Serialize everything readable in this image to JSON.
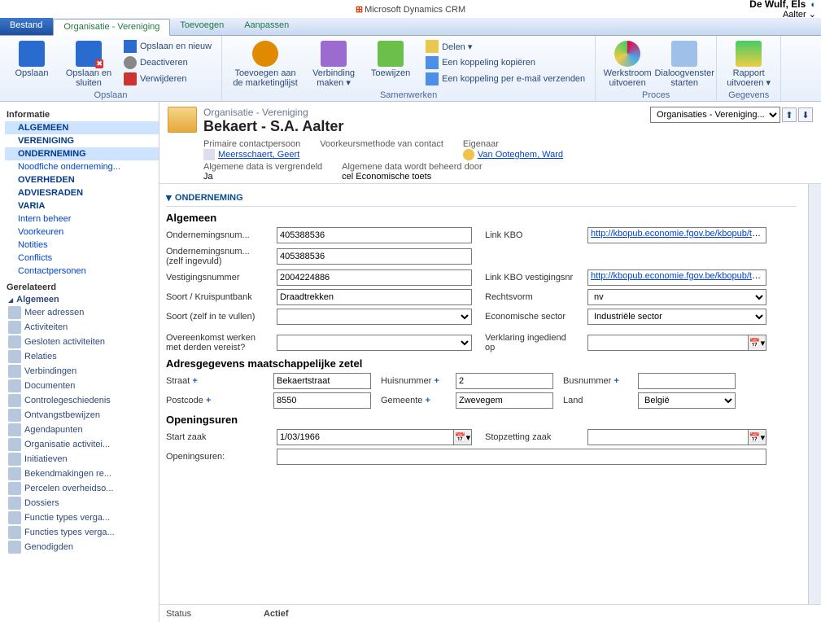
{
  "app": {
    "title": "Microsoft Dynamics CRM"
  },
  "user": {
    "name": "De Wulf, Els",
    "org": "Aalter"
  },
  "tabs": {
    "bestand": "Bestand",
    "entity": "Organisatie - Vereniging",
    "toevoegen": "Toevoegen",
    "aanpassen": "Aanpassen"
  },
  "ribbon": {
    "groups": {
      "opslaan": "Opslaan",
      "samenwerken": "Samenwerken",
      "proces": "Proces",
      "gegevens": "Gegevens"
    },
    "save": "Opslaan",
    "saveclose": "Opslaan en sluiten",
    "savenew": "Opslaan en nieuw",
    "deactivate": "Deactiveren",
    "delete": "Verwijderen",
    "marketing": "Toevoegen aan de marketinglijst",
    "connect": "Verbinding maken ▾",
    "assign": "Toewijzen",
    "share": "Delen ▾",
    "copylink": "Een koppeling kopiëren",
    "maillink": "Een koppeling per e-mail verzenden",
    "workflow": "Werkstroom uitvoeren",
    "dialog": "Dialoogvenster starten",
    "report": "Rapport uitvoeren ▾"
  },
  "leftnav": {
    "info": "Informatie",
    "items": [
      "ALGEMEEN",
      "VERENIGING",
      "ONDERNEMING",
      "Noodfiche onderneming...",
      "OVERHEDEN",
      "ADVIESRADEN",
      "VARIA",
      "Intern beheer",
      "Voorkeuren",
      "Notities",
      "Conflicts",
      "Contactpersonen"
    ],
    "related_hdr": "Gerelateerd",
    "related_group": "Algemeen",
    "related": [
      "Meer adressen",
      "Activiteiten",
      "Gesloten activiteiten",
      "Relaties",
      "Verbindingen",
      "Documenten",
      "Controlegeschiedenis",
      "Ontvangstbewijzen",
      "Agendapunten",
      "Organisatie activitei...",
      "Initiatieven",
      "Bekendmakingen re...",
      "Percelen overheidso...",
      "Dossiers",
      "Functie types verga...",
      "Functies types verga...",
      "Genodigden"
    ]
  },
  "header": {
    "typelabel": "Organisatie - Vereniging",
    "title": "Bekaert - S.A. Aalter",
    "view_select": "Organisaties - Vereniging... ▾",
    "primary_contact_lbl": "Primaire contactpersoon",
    "primary_contact": "Meersschaert, Geert",
    "pref_method_lbl": "Voorkeursmethode van contact",
    "pref_method": "",
    "owner_lbl": "Eigenaar",
    "owner": "Van Ooteghem, Ward",
    "locked_lbl": "Algemene data is vergrendeld",
    "locked_val": "Ja",
    "managedby_lbl": "Algemene data wordt beheerd door",
    "managedby_val": "cel Economische toets"
  },
  "section": {
    "title": "ONDERNEMING",
    "sub1": "Algemeen",
    "sub2": "Adresgegevens maatschappelijke zetel",
    "sub3": "Openingsuren"
  },
  "fields": {
    "ondnr_lbl": "Ondernemingsnum...",
    "ondnr": "405388536",
    "ondnr2_lbl": "Ondernemingsnum... (zelf ingevuld)",
    "ondnr2": "405388536",
    "linkkbo_lbl": "Link KBO",
    "linkkbo": "http://kbopub.economie.fgov.be/kbopub/toon",
    "vestnr_lbl": "Vestigingsnummer",
    "vestnr": "2004224886",
    "linkkbovest_lbl": "Link KBO vestigingsnr",
    "linkkbovest": "http://kbopub.economie.fgov.be/kbopub/toon",
    "soortkb_lbl": "Soort / Kruispuntbank",
    "soortkb": "Draadtrekken",
    "rechtsvorm_lbl": "Rechtsvorm",
    "rechtsvorm": "nv",
    "soortzelf_lbl": "Soort (zelf in te vullen)",
    "soortzelf": "",
    "econsector_lbl": "Economische sector",
    "econsector": "Industriële sector",
    "overeenkomst_lbl": "Overeenkomst werken met derden vereist?",
    "overeenkomst": "",
    "verklaring_lbl": "Verklaring ingediend op",
    "verklaring": "",
    "straat_lbl": "Straat",
    "straat": "Bekaertstraat",
    "huisnr_lbl": "Huisnummer",
    "huisnr": "2",
    "busnr_lbl": "Busnummer",
    "busnr": "",
    "postcode_lbl": "Postcode",
    "postcode": "8550",
    "gemeente_lbl": "Gemeente",
    "gemeente": "Zwevegem",
    "land_lbl": "Land",
    "land": "België",
    "start_lbl": "Start zaak",
    "start": "1/03/1966",
    "stop_lbl": "Stopzetting zaak",
    "stop": "",
    "openuren_lbl": "Openingsuren:"
  },
  "status": {
    "label": "Status",
    "value": "Actief"
  }
}
